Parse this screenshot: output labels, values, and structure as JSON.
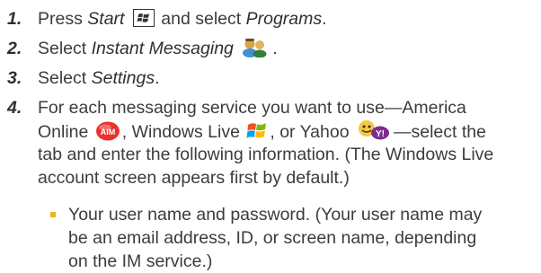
{
  "steps": [
    {
      "number": "1.",
      "text_a": "Press ",
      "emph_a": "Start",
      "text_b": " and select ",
      "emph_b": "Programs",
      "text_c": ".",
      "icon": "windows-start-key-icon"
    },
    {
      "number": "2.",
      "text_a": "Select ",
      "emph_a": "Instant Messaging",
      "text_c": ".",
      "icon": "instant-messaging-icon"
    },
    {
      "number": "3.",
      "text_a": "Select ",
      "emph_a": "Settings",
      "text_c": "."
    },
    {
      "number": "4.",
      "line1": "For each messaging service you want to use—America",
      "line2_a": "Online ",
      "line2_b": ", Windows Live ",
      "line2_c": ", or Yahoo ",
      "line2_d": "—select the",
      "line3": "tab and enter the following information. (The Windows Live",
      "line4": "account screen appears first by default.)",
      "icons": [
        "aim-icon",
        "windows-live-icon",
        "yahoo-messenger-icon"
      ]
    }
  ],
  "bullet": {
    "line1": "Your user name and password. (Your user name may",
    "line2": "be an email address, ID, or screen name, depending",
    "line3": "on the IM service.)"
  },
  "colors": {
    "text": "#3c3c3c",
    "bullet": "#f2b21b",
    "aim": "#e8322e",
    "yahoo": "#7b2d8e"
  }
}
